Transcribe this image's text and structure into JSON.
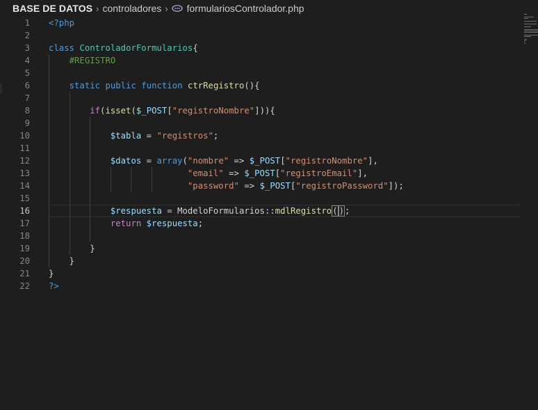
{
  "breadcrumb": {
    "root": "BASE DE DATOS",
    "folder": "controladores",
    "file": "formulariosControlador.php",
    "separator": "›"
  },
  "icons": {
    "separator": "chevron-right-icon",
    "file": "php-file-icon"
  },
  "colors": {
    "background": "#1e1e1e",
    "keyword": "#569cd6",
    "control": "#c586c0",
    "function": "#dcdcaa",
    "class": "#4ec9b0",
    "variable": "#9cdcfe",
    "string": "#ce9178",
    "comment": "#6a9955"
  },
  "editor": {
    "active_line": 16,
    "lines": [
      {
        "n": "1",
        "t": "<?php"
      },
      {
        "n": "2",
        "t": ""
      },
      {
        "n": "3",
        "t": "class ControladorFormularios{"
      },
      {
        "n": "4",
        "t": "    #REGISTRO"
      },
      {
        "n": "5",
        "t": ""
      },
      {
        "n": "6",
        "t": "    static public function ctrRegistro(){"
      },
      {
        "n": "7",
        "t": ""
      },
      {
        "n": "8",
        "t": "        if(isset($_POST[\"registroNombre\"])){"
      },
      {
        "n": "9",
        "t": ""
      },
      {
        "n": "10",
        "t": "            $tabla = \"registros\";"
      },
      {
        "n": "11",
        "t": ""
      },
      {
        "n": "12",
        "t": "            $datos = array(\"nombre\" => $_POST[\"registroNombre\"],"
      },
      {
        "n": "13",
        "t": "                           \"email\" => $_POST[\"registroEmail\"],"
      },
      {
        "n": "14",
        "t": "                           \"password\" => $_POST[\"registroPassword\"]);"
      },
      {
        "n": "15",
        "t": ""
      },
      {
        "n": "16",
        "t": "            $respuesta = ModeloFormularios::mdlRegistro();"
      },
      {
        "n": "17",
        "t": "            return $respuesta;"
      },
      {
        "n": "18",
        "t": ""
      },
      {
        "n": "19",
        "t": "        }"
      },
      {
        "n": "20",
        "t": "    }"
      },
      {
        "n": "21",
        "t": "}"
      },
      {
        "n": "22",
        "t": "?>"
      }
    ]
  }
}
